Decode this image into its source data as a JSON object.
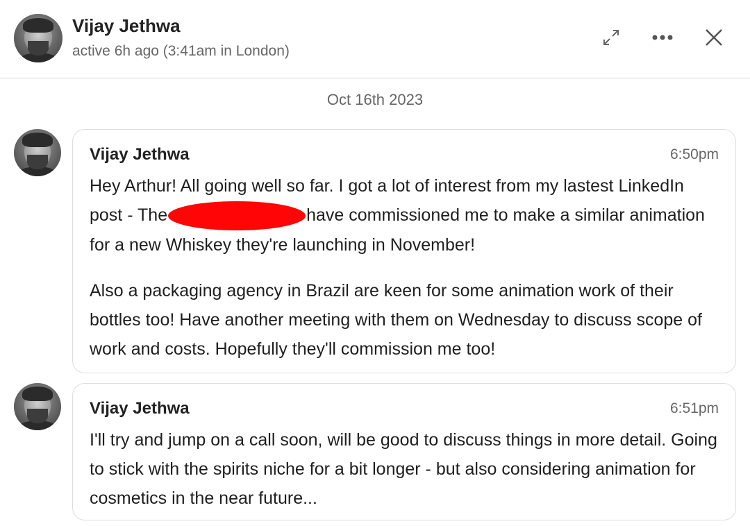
{
  "header": {
    "name": "Vijay Jethwa",
    "status": "active 6h ago (3:41am in London)",
    "icons": [
      "expand-icon",
      "more-icon",
      "close-icon"
    ]
  },
  "date_separator": "Oct 16th 2023",
  "messages": [
    {
      "sender": "Vijay Jethwa",
      "time": "6:50pm",
      "p1_before": "Hey Arthur! All going well so far. I got a lot of interest from my lastest LinkedIn post - The",
      "p1_after": "have commissioned me to make a similar animation for a new Whiskey they're launching in November!",
      "p2": "Also a packaging agency in Brazil are keen for some animation work of their bottles too! Have another meeting with them on Wednesday to discuss scope of work and costs. Hopefully they'll commission me too!"
    },
    {
      "sender": "Vijay Jethwa",
      "time": "6:51pm",
      "p1": "I'll try and jump on a call soon, will be good to discuss things in more detail. Going to stick with the spirits niche for a bit longer - but also considering animation for cosmetics in the near future..."
    }
  ],
  "colors": {
    "redaction": "#ff0505",
    "border": "#dedede",
    "muted_text": "#666666"
  }
}
